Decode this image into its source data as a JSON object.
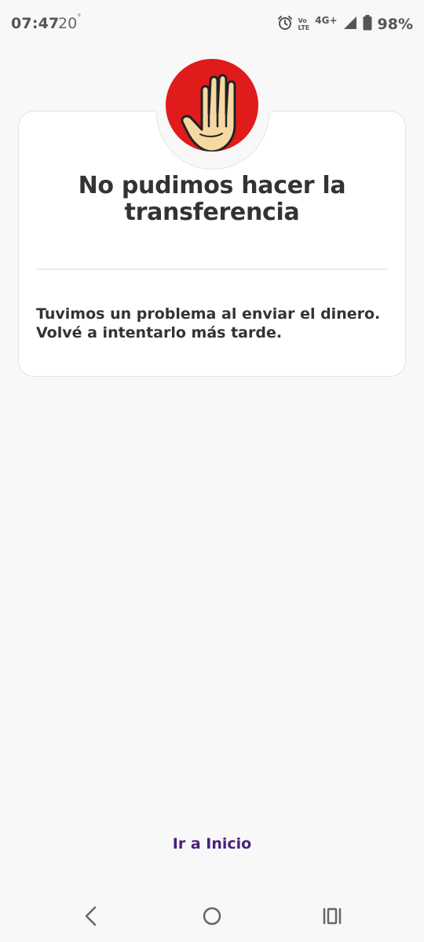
{
  "status_bar": {
    "time": "07:47",
    "temperature": "20",
    "degree_symbol": "°",
    "volte_top": "Vo",
    "volte_bottom": "LTE",
    "network": "4G+",
    "battery": "98%",
    "icons": [
      "alarm-icon",
      "volte-icon",
      "signal-icon",
      "battery-icon"
    ]
  },
  "error_card": {
    "icon": "stop-hand-icon",
    "icon_color": "#e01b1b",
    "title": "No pudimos hacer la transferencia",
    "message_line1": "Tuvimos un problema al enviar el dinero.",
    "message_line2": "Volvé a intentarlo más tarde."
  },
  "actions": {
    "home_link": "Ir a Inicio",
    "link_color": "#4b1f7e"
  },
  "nav_bar": {
    "icons": [
      "back-icon",
      "home-icon",
      "recents-icon"
    ]
  }
}
